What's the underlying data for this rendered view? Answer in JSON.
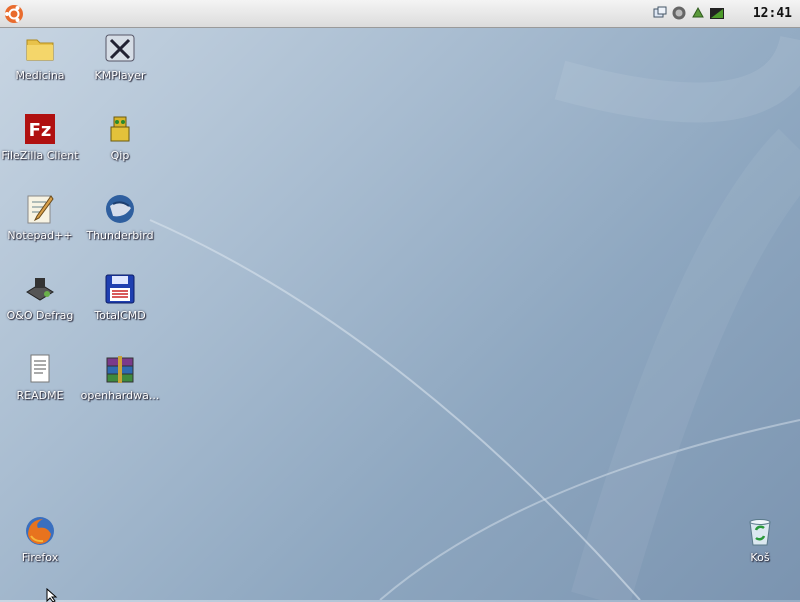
{
  "taskbar": {
    "clock": "12:41",
    "tray_icons": [
      "network-icon",
      "volume-icon",
      "update-icon",
      "power-icon"
    ]
  },
  "desktop": {
    "icons": [
      {
        "label": "Medicina",
        "icon": "folder-icon"
      },
      {
        "label": "KMPlayer",
        "icon": "kmplayer-icon"
      },
      {
        "label": "FileZilla Client",
        "icon": "filezilla-icon"
      },
      {
        "label": "Qip",
        "icon": "qip-icon"
      },
      {
        "label": "Notepad++",
        "icon": "notepad-icon"
      },
      {
        "label": "Thunderbird",
        "icon": "thunderbird-icon"
      },
      {
        "label": "O&O Defrag",
        "icon": "defrag-icon"
      },
      {
        "label": "TotalCMD",
        "icon": "totalcmd-icon"
      },
      {
        "label": "README",
        "icon": "document-icon"
      },
      {
        "label": "openhardwa...",
        "icon": "archive-icon"
      },
      {
        "label": "Firefox",
        "icon": "firefox-icon"
      },
      {
        "label": "Koš",
        "icon": "recycle-bin-icon"
      }
    ]
  },
  "colors": {
    "wallpaper": "#8ea7c0",
    "label_text": "#ffffff",
    "topbar": "#e6e6e6"
  }
}
